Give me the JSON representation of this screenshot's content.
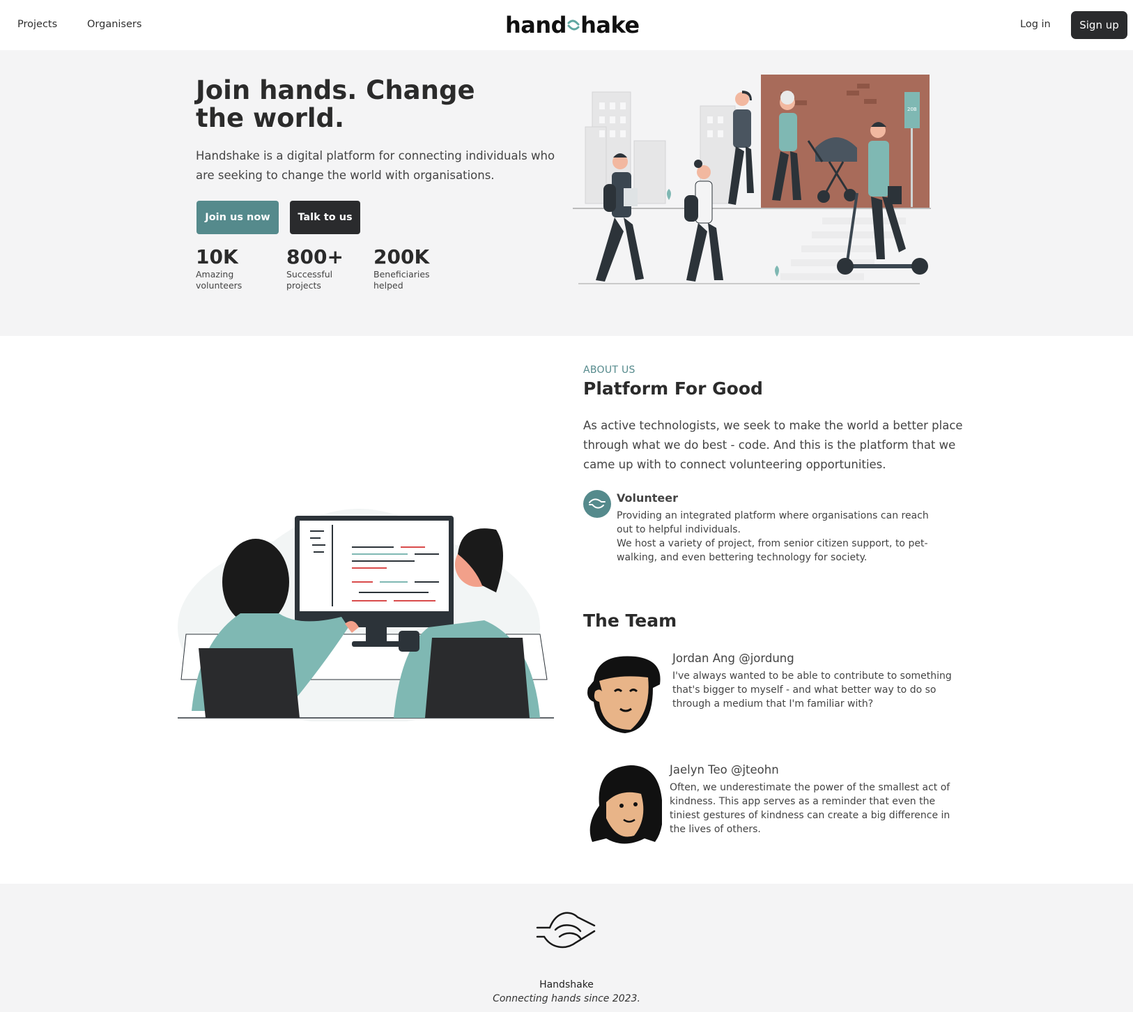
{
  "nav": {
    "projects": "Projects",
    "organisers": "Organisers",
    "brand_left": "hand",
    "brand_right": "hake",
    "login": "Log in",
    "signup": "Sign up"
  },
  "hero": {
    "title": "Join hands. Change the world.",
    "lead": "Handshake is a digital platform for connecting individuals who are seeking to change the world with organisations.",
    "join_button": "Join us now",
    "talk_button": "Talk to us",
    "stats": [
      {
        "value": "10K",
        "label": "Amazing volunteers"
      },
      {
        "value": "800+",
        "label": "Successful projects"
      },
      {
        "value": "200K",
        "label": "Beneficiaries helped"
      }
    ],
    "bus_stop_sign": "20B"
  },
  "about": {
    "eyebrow": "ABOUT US",
    "title": "Platform For Good",
    "body": "As active technologists, we seek to make the world a better place through what we do best - code. And this is the platform that we came up with to connect volunteering opportunities.",
    "volunteer_title": "Volunteer",
    "volunteer_text_1": "Providing an integrated platform where organisations can reach out to helpful individuals.",
    "volunteer_text_2": "We host a variety of project, from senior citizen support, to pet-walking, and even bettering technology for society."
  },
  "team": {
    "title": "The Team",
    "members": [
      {
        "name": "Jordan Ang @jordung",
        "quote": "I've always wanted to be able to contribute to something that's bigger to myself - and what better way to do so through a medium that I'm familiar with?"
      },
      {
        "name": "Jaelyn Teo @jteohn",
        "quote": "Often, we underestimate the power of the smallest act of kindness. This app serves as a reminder that even the tiniest gestures of kindness can create a big difference in the lives of others."
      }
    ]
  },
  "footer": {
    "name": "Handshake",
    "tagline": "Connecting hands since 2023."
  },
  "colors": {
    "accent": "#558a8c",
    "dark": "#2a2b2d",
    "hero_bg": "#f4f4f5",
    "teal_light": "#7fb8b3",
    "brick": "#a86b5a"
  },
  "icons": [
    "handshake-logo-icon",
    "handshake-icon",
    "footer-handshake-icon"
  ]
}
